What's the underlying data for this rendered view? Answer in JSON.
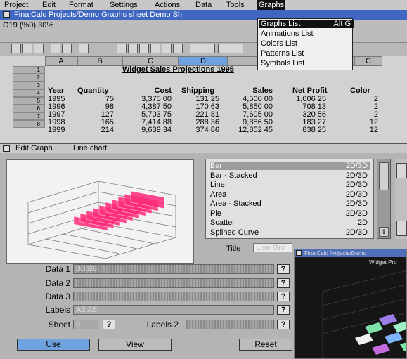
{
  "menubar": {
    "items": [
      "Project",
      "Edit",
      "Format",
      "Settings",
      "Actions",
      "Data",
      "Tools",
      "Graphs"
    ]
  },
  "window": {
    "title": "FinalCalc Projects/Demo Graphs sheet Demo Sh"
  },
  "cell_ref": "O19 (%0) 30%",
  "graphs_menu": {
    "items": [
      {
        "label": "Graphs List",
        "shortcut": "Alt G"
      },
      {
        "label": "Animations List"
      },
      {
        "label": "Colors List"
      },
      {
        "label": "Patterns List"
      },
      {
        "label": "Symbols List"
      }
    ]
  },
  "sheet": {
    "columns": [
      "A",
      "B",
      "C",
      "D",
      "",
      "C"
    ],
    "title": "Widget Sales Projections  1995",
    "rows": [
      "1",
      "2",
      "3",
      "4",
      "5",
      "6",
      "7",
      "8"
    ],
    "headers": [
      "Year",
      "Quantity",
      "Cost",
      "Shipping",
      "Sales",
      "Net Profit",
      "Color"
    ],
    "data": [
      [
        "1995",
        "75",
        "3,375 00",
        "131 25",
        "4,500 00",
        "1,006 25",
        "2"
      ],
      [
        "1996",
        "98",
        "4,387 50",
        "170 63",
        "5,850 00",
        "708 13",
        "2"
      ],
      [
        "1997",
        "127",
        "5,703 75",
        "221 81",
        "7,605 00",
        "320 56",
        "2"
      ],
      [
        "1998",
        "165",
        "7,414 88",
        "288 36",
        "9,886 50",
        "183 27",
        "12"
      ],
      [
        "1999",
        "214",
        "9,639 34",
        "374 86",
        "12,852 45",
        "838 25",
        "12"
      ]
    ]
  },
  "edit_graph": {
    "title": "Edit Graph",
    "subtitle": "Line chart",
    "types": [
      {
        "label": "Bar",
        "dim": "2D/3D"
      },
      {
        "label": "Bar - Stacked",
        "dim": "2D/3D"
      },
      {
        "label": "Line",
        "dim": "2D/3D"
      },
      {
        "label": "Area",
        "dim": "2D/3D"
      },
      {
        "label": "Area - Stacked",
        "dim": "2D/3D"
      },
      {
        "label": "Pie",
        "dim": "2D/3D"
      },
      {
        "label": "Scatter",
        "dim": "2D"
      },
      {
        "label": "Splined Curve",
        "dim": "2D/3D"
      }
    ],
    "title_label": "Title",
    "title_value": "Line Gro",
    "labels": {
      "data1": "Data 1",
      "data2": "Data 2",
      "data3": "Data 3",
      "labels": "Labels",
      "sheet": "Sheet",
      "labels2": "Labels 2"
    },
    "data1_value": "B3:B8",
    "labels_value": "A3:A8",
    "sheet_value": "0",
    "q": "?",
    "buttons": {
      "use": "Use",
      "view": "View",
      "reset": "Reset"
    }
  },
  "inset": {
    "title": "FinalCalc Projects/Demo",
    "chart_title": "Widget Pro"
  },
  "colors": {
    "menubar": "#c8c8c8",
    "titlebar": "#3f66c0",
    "selection": "#6fa3e0",
    "bar_pink": "#ff2b7a"
  }
}
